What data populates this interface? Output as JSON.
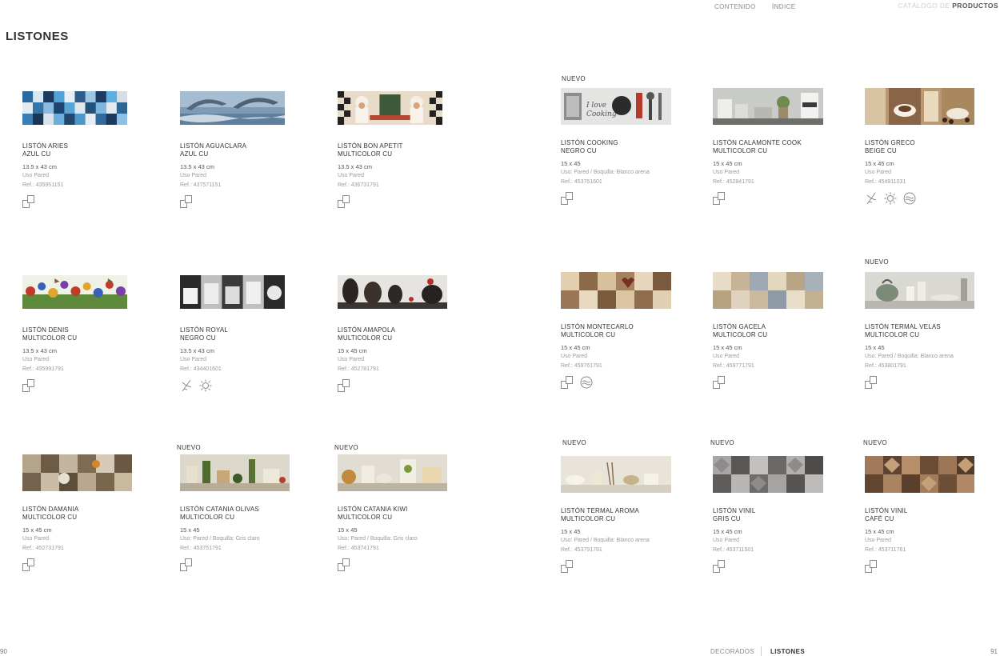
{
  "nav": {
    "contenido": "CONTENIDO",
    "indice": "ÍNDICE",
    "catalog_prefix": "CATÁLOGO DE",
    "catalog_main": "PRODUCTOS"
  },
  "page_title": "LISTONES",
  "badge_text": "NUEVO",
  "colors": {
    "text": "#2a2a2a",
    "muted": "#9a9a9a",
    "background": "#ffffff"
  },
  "products": [
    {
      "badge": "",
      "name1": "LISTÓN ARIES",
      "name2": "AZUL CU",
      "size": "13.5 x 43 cm",
      "use": "Uso Pared",
      "ref": "Ref.: 435951151",
      "icons": [
        "wall-tile-icon"
      ]
    },
    {
      "badge": "",
      "name1": "LISTÓN AGUACLARA",
      "name2": "AZUL CU",
      "size": "13.5 x 43 cm",
      "use": "Uso Pared",
      "ref": "Ref.: 437571151",
      "icons": [
        "wall-tile-icon"
      ]
    },
    {
      "badge": "",
      "name1": "LISTÓN BON APETIT",
      "name2": "MULTICOLOR CU",
      "size": "13.5 x 43 cm",
      "use": "Uso Pared",
      "ref": "Ref.: 436731791",
      "icons": [
        "wall-tile-icon"
      ]
    },
    {
      "badge": "NUEVO",
      "name1": "LISTÓN COOKING",
      "name2": "NEGRO CU",
      "size": "15 x 45",
      "use": "Uso: Pared  /  Boquilla: Blanco arena",
      "ref": "Ref.: 453761601",
      "icons": [
        "wall-tile-icon"
      ]
    },
    {
      "badge": "",
      "name1": "LISTÓN CALAMONTE COOK",
      "name2": "MULTICOLOR CU",
      "size": "15 x 45 cm",
      "use": "Uso Pared",
      "ref": "Ref.: 452841791",
      "icons": [
        "wall-tile-icon"
      ]
    },
    {
      "badge": "",
      "name1": "LISTÓN GRECO",
      "name2": "BEIGE CU",
      "size": "15 x 45 cm",
      "use": "Uso Pared",
      "ref": "Ref.: 454911031",
      "icons": [
        "frost-icon",
        "sun-icon",
        "water-icon"
      ]
    },
    {
      "badge": "",
      "name1": "LISTÓN DENIS",
      "name2": "MULTICOLOR CU",
      "size": "13.5 x 43 cm",
      "use": "Uso Pared",
      "ref": "Ref.: 435991791",
      "icons": [
        "wall-tile-icon"
      ]
    },
    {
      "badge": "",
      "name1": "LISTÓN ROYAL",
      "name2": "NEGRO CU",
      "size": "13.5 x 43 cm",
      "use": "Uso Pared",
      "ref": "Ref.: 434401601",
      "icons": [
        "frost-icon",
        "sun-icon"
      ]
    },
    {
      "badge": "",
      "name1": "LISTÓN AMAPOLA",
      "name2": "MULTICOLOR CU",
      "size": "15 x 45 cm",
      "use": "Uso Pared",
      "ref": "Ref.: 452781791",
      "icons": [
        "wall-tile-icon"
      ]
    },
    {
      "badge": "",
      "name1": "LISTÓN MONTECARLO",
      "name2": "MULTICOLOR CU",
      "size": "15 x 45 cm",
      "use": "Uso Pared",
      "ref": "Ref.: 459761791",
      "icons": [
        "wall-tile-icon",
        "water-icon"
      ]
    },
    {
      "badge": "",
      "name1": "LISTÓN GACELA",
      "name2": "MULTICOLOR CU",
      "size": "15 x 45 cm",
      "use": "Uso Pared",
      "ref": "Ref.: 459771791",
      "icons": [
        "wall-tile-icon"
      ]
    },
    {
      "badge": "NUEVO",
      "name1": "LISTÓN TERMAL VELAS",
      "name2": "MULTICOLOR CU",
      "size": "15 x 45",
      "use": "Uso: Pared  /  Boquilla: Blanco arena",
      "ref": "Ref.: 453801791",
      "icons": [
        "wall-tile-icon"
      ]
    },
    {
      "badge": "",
      "name1": "LISTÓN DAMANIA",
      "name2": "MULTICOLOR CU",
      "size": "15 x 45 cm",
      "use": "Uso Pared",
      "ref": "Ref.: 452731791",
      "icons": [
        "wall-tile-icon"
      ]
    },
    {
      "badge": "NUEVO",
      "name1": "LISTÓN CATANIA OLIVAS",
      "name2": "MULTICOLOR CU",
      "size": "15 x 45",
      "use": "Uso: Pared  /  Boquilla: Gris claro",
      "ref": "Ref.: 453751791",
      "icons": [
        "wall-tile-icon"
      ]
    },
    {
      "badge": "NUEVO",
      "name1": "LISTÓN CATANIA KIWI",
      "name2": "MULTICOLOR CU",
      "size": "15 x 45",
      "use": "Uso: Pared  /  Boquilla: Gris claro",
      "ref": "Ref.: 453741791",
      "icons": [
        "wall-tile-icon"
      ]
    },
    {
      "badge": "NUEVO",
      "name1": "LISTÓN TERMAL AROMA",
      "name2": "MULTICOLOR CU",
      "size": "15 x 45",
      "use": "Uso: Pared  /  Boquilla: Blanco arena",
      "ref": "Ref.: 453791791",
      "icons": [
        "wall-tile-icon"
      ]
    },
    {
      "badge": "NUEVO",
      "name1": "LISTÓN VINIL",
      "name2": "GRIS CU",
      "size": "15 x 45 cm",
      "use": "Uso Pared",
      "ref": "Ref.: 453711501",
      "icons": [
        "wall-tile-icon"
      ]
    },
    {
      "badge": "NUEVO",
      "name1": "LISTÓN VINIL",
      "name2": "CAFÉ CU",
      "size": "15 x 45 cm",
      "use": "Uso Pared",
      "ref": "Ref.: 453711761",
      "icons": [
        "wall-tile-icon"
      ]
    }
  ],
  "footer": {
    "page_left": "90",
    "page_right": "91",
    "section_prev": "DECORADOS",
    "section_current": "LISTONES"
  }
}
